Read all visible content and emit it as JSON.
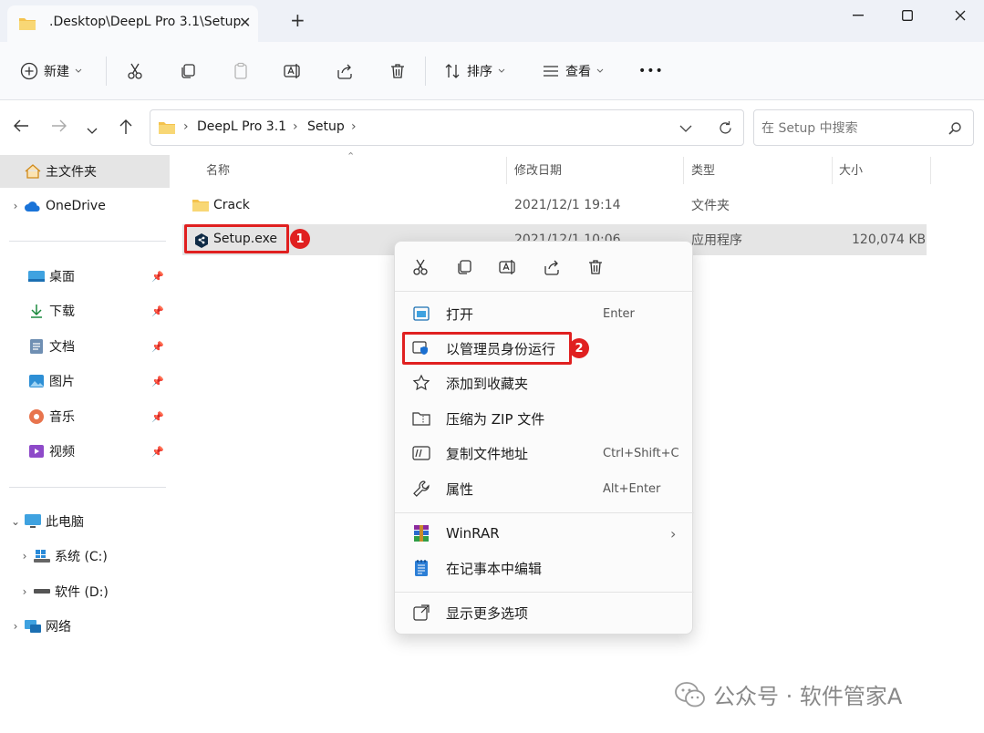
{
  "window": {
    "tab_title": ".Desktop\\DeepL Pro 3.1\\Setup",
    "tab_close": "✕",
    "new_tab": "+"
  },
  "toolbar": {
    "new_label": "新建",
    "sort_label": "排序",
    "view_label": "查看",
    "more_label": "•••"
  },
  "address": {
    "crumbs": [
      "DeepL Pro 3.1",
      "Setup"
    ],
    "search_placeholder": "在 Setup 中搜索"
  },
  "sidebar": {
    "home": "主文件夹",
    "onedrive": "OneDrive",
    "quick": [
      {
        "label": "桌面",
        "icon": "desktop-icon"
      },
      {
        "label": "下载",
        "icon": "download-icon"
      },
      {
        "label": "文档",
        "icon": "document-icon"
      },
      {
        "label": "图片",
        "icon": "picture-icon"
      },
      {
        "label": "音乐",
        "icon": "music-icon"
      },
      {
        "label": "视频",
        "icon": "video-icon"
      }
    ],
    "this_pc": "此电脑",
    "drives": [
      "系统 (C:)",
      "软件 (D:)"
    ],
    "network": "网络"
  },
  "columns": {
    "name": "名称",
    "modified": "修改日期",
    "type": "类型",
    "size": "大小"
  },
  "files": [
    {
      "name": "Crack",
      "modified": "2021/12/1 19:14",
      "type": "文件夹",
      "size": ""
    },
    {
      "name": "Setup.exe",
      "modified": "2021/12/1 10:06",
      "type": "应用程序",
      "size": "120,074 KB"
    }
  ],
  "context_menu": {
    "items": [
      {
        "label": "打开",
        "shortcut": "Enter"
      },
      {
        "label": "以管理员身份运行",
        "shortcut": ""
      },
      {
        "label": "添加到收藏夹",
        "shortcut": ""
      },
      {
        "label": "压缩为 ZIP 文件",
        "shortcut": ""
      },
      {
        "label": "复制文件地址",
        "shortcut": "Ctrl+Shift+C"
      },
      {
        "label": "属性",
        "shortcut": "Alt+Enter"
      }
    ],
    "winrar": "WinRAR",
    "notepad": "在记事本中编辑",
    "more": "显示更多选项"
  },
  "annotations": {
    "badge1": "1",
    "badge2": "2"
  },
  "watermark": "公众号 · 软件管家A",
  "colors": {
    "highlight_red": "#e02020",
    "selected_row": "#e5e5e5",
    "accent_blue": "#0067c0"
  }
}
